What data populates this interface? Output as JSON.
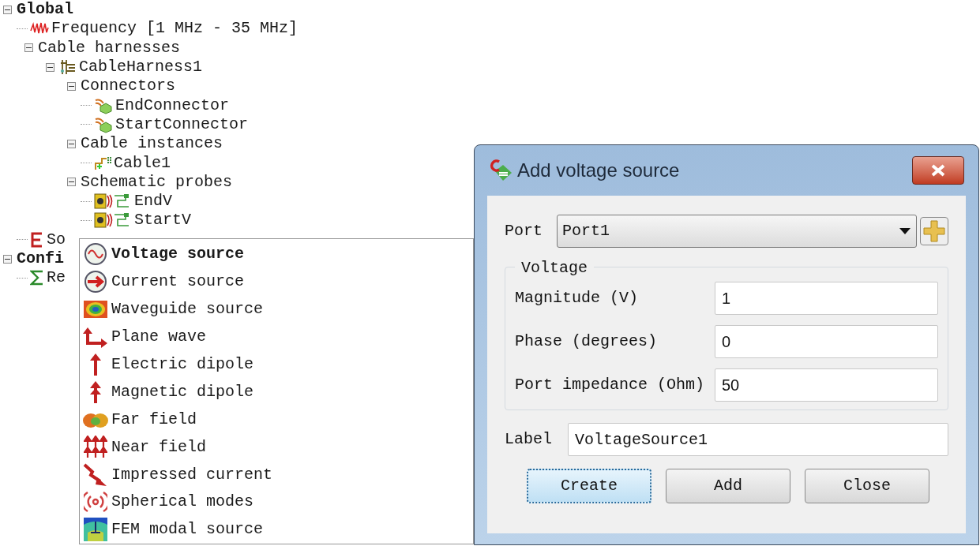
{
  "tree": [
    {
      "label": "Global",
      "kind": "root",
      "expanded": true,
      "children": [
        {
          "label": "Frequency [1 MHz - 35 MHz]",
          "kind": "frequency"
        },
        {
          "label": "Cable harnesses",
          "expanded": true,
          "children": [
            {
              "label": "CableHarness1",
              "kind": "harness",
              "expanded": true,
              "children": [
                {
                  "label": "Connectors",
                  "expanded": true,
                  "children": [
                    {
                      "label": "EndConnector",
                      "kind": "connector"
                    },
                    {
                      "label": "StartConnector",
                      "kind": "connector"
                    }
                  ]
                },
                {
                  "label": "Cable instances",
                  "expanded": true,
                  "children": [
                    {
                      "label": "Cable1",
                      "kind": "cable"
                    }
                  ]
                },
                {
                  "label": "Schematic probes",
                  "expanded": true,
                  "children": [
                    {
                      "label": "EndV",
                      "kind": "probe"
                    },
                    {
                      "label": "StartV",
                      "kind": "probe"
                    }
                  ]
                }
              ]
            }
          ]
        },
        {
          "label": "So",
          "kind": "sources"
        }
      ]
    },
    {
      "label": "Confi",
      "kind": "root",
      "expanded": true,
      "children": [
        {
          "label": "Re",
          "kind": "result"
        }
      ]
    }
  ],
  "menu": [
    {
      "label": "Voltage source",
      "kind": "voltage",
      "default": true
    },
    {
      "label": "Current source",
      "kind": "current",
      "default": false
    },
    {
      "label": "Waveguide source",
      "kind": "waveguide",
      "default": false
    },
    {
      "label": "Plane wave",
      "kind": "planewave",
      "default": false
    },
    {
      "label": "Electric dipole",
      "kind": "edipole",
      "default": false
    },
    {
      "label": "Magnetic dipole",
      "kind": "mdipole",
      "default": false
    },
    {
      "label": "Far field",
      "kind": "farfield",
      "default": false
    },
    {
      "label": "Near field",
      "kind": "nearfield",
      "default": false
    },
    {
      "label": "Impressed current",
      "kind": "impressed",
      "default": false
    },
    {
      "label": "Spherical modes",
      "kind": "spherical",
      "default": false
    },
    {
      "label": "FEM modal source",
      "kind": "fem",
      "default": false
    }
  ],
  "dialog": {
    "title": "Add voltage source",
    "port": {
      "label": "Port",
      "value": "Port1"
    },
    "group": {
      "title": "Voltage",
      "fields": [
        {
          "label": "Magnitude (V)",
          "value": "1"
        },
        {
          "label": "Phase (degrees)",
          "value": "0"
        },
        {
          "label": "Port impedance (Ohm)",
          "value": "50"
        }
      ]
    },
    "label_field": {
      "label": "Label",
      "value": "VoltageSource1"
    },
    "buttons": [
      {
        "label": "Create",
        "focused": true
      },
      {
        "label": "Add",
        "focused": false
      },
      {
        "label": "Close",
        "focused": false
      }
    ]
  }
}
